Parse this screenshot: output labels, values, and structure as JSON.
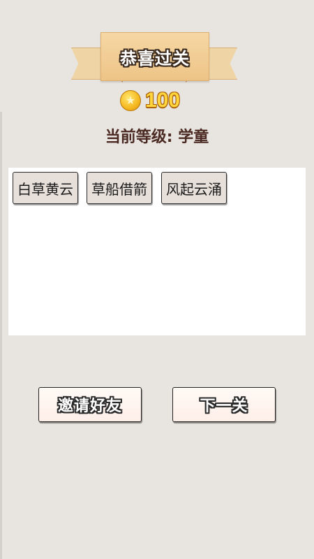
{
  "banner": {
    "title": "恭喜过关"
  },
  "coins": {
    "icon": "coin-star-icon",
    "count": "100"
  },
  "level": {
    "text": "当前等级: 学童"
  },
  "idioms": [
    {
      "label": "白草黄云"
    },
    {
      "label": "草船借箭"
    },
    {
      "label": "风起云涌"
    }
  ],
  "actions": {
    "invite_label": "邀请好友",
    "next_label": "下一关"
  },
  "colors": {
    "background": "#e8e4df",
    "banner": "#f2cd92",
    "coin": "#ffd43c",
    "level_text": "#4a2a22",
    "chip": "#e6dfda",
    "button": "#fdeee8"
  }
}
